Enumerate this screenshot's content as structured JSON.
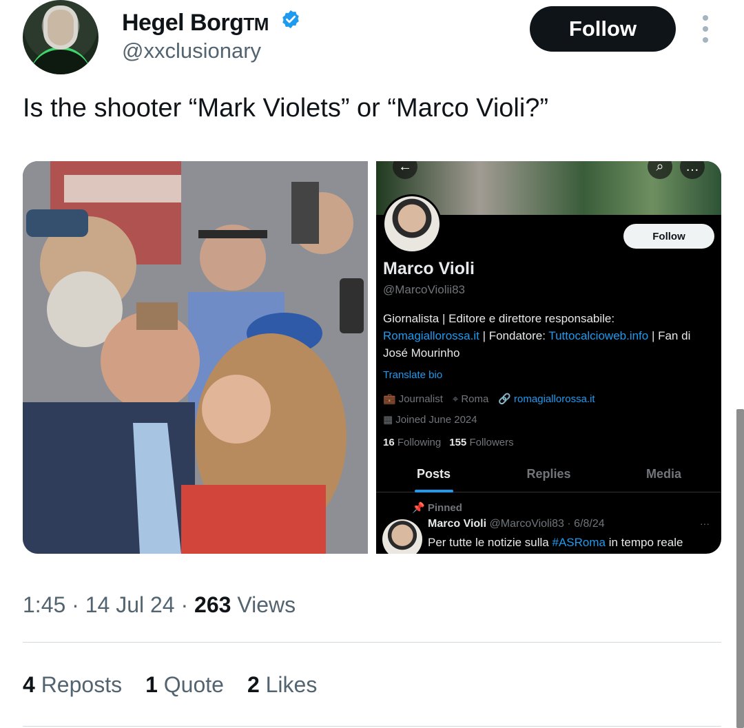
{
  "author": {
    "name": "Hegel Borg",
    "trademark": "TM",
    "handle": "@xxclusionary",
    "verified_color": "#1d9bf0"
  },
  "header": {
    "follow_label": "Follow"
  },
  "tweet": {
    "text": "Is the shooter “Mark Violets” or “Marco Violi?”"
  },
  "embedded_profile": {
    "follow_label": "Follow",
    "name": "Marco Violi",
    "handle": "@MarcoViolii83",
    "bio_1": "Giornalista | Editore e direttore responsabile:",
    "bio_link_1": "Romagiallorossa.it",
    "bio_2": " | Fondatore: ",
    "bio_link_2": "Tuttocalcioweb.info",
    "bio_3": " | Fan di José Mourinho",
    "translate_label": "Translate bio",
    "profession": "Journalist",
    "location": "Roma",
    "website": "romagiallorossa.it",
    "joined": "Joined June 2024",
    "following_count": "16",
    "following_label": "Following",
    "followers_count": "155",
    "followers_label": "Followers",
    "tabs": [
      "Posts",
      "Replies",
      "Media"
    ],
    "pinned_label": "Pinned",
    "pinned_name": "Marco Violi",
    "pinned_handle_date": "@MarcoVioli83 · 6/8/24",
    "pinned_text_1": "Per tutte le notizie sulla ",
    "pinned_hashtag": "#ASRoma",
    "pinned_text_2": " in tempo reale"
  },
  "meta": {
    "time": "1:45",
    "date": "14 Jul 24",
    "views_count": "263",
    "views_label": "Views"
  },
  "stats": {
    "reposts_count": "4",
    "reposts_label": "Reposts",
    "quotes_count": "1",
    "quotes_label": "Quote",
    "likes_count": "2",
    "likes_label": "Likes"
  }
}
